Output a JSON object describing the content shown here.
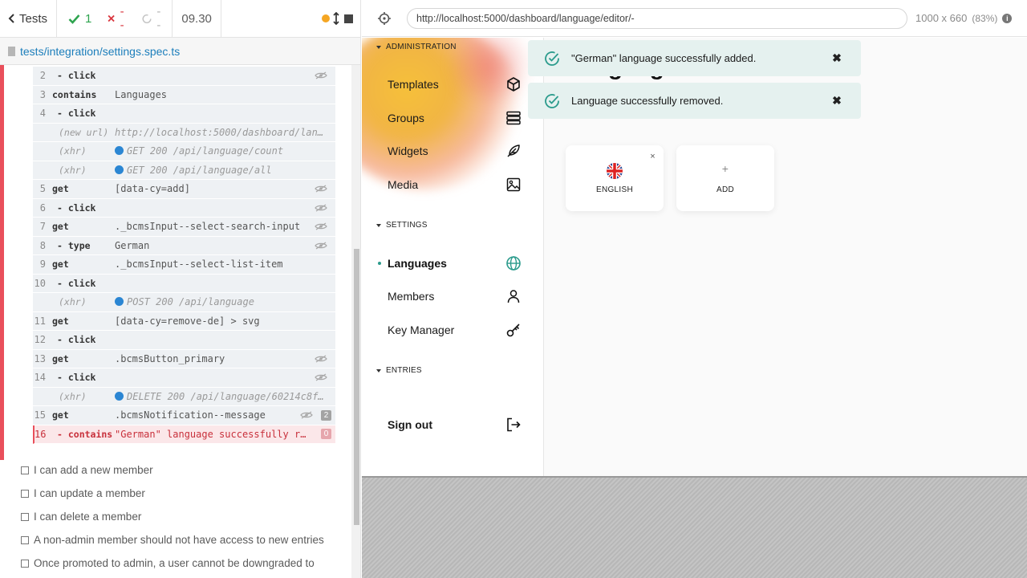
{
  "reporter": {
    "back_label": "Tests",
    "passed": "1",
    "failed": "--",
    "pending": "--",
    "duration": "09.30",
    "spec_path": "tests/integration/settings.spec.ts"
  },
  "commands": [
    {
      "num": "2",
      "name": "- click",
      "msg": "",
      "kind": "sub",
      "eye": true
    },
    {
      "num": "3",
      "name": "contains",
      "msg": "Languages",
      "kind": "cmd"
    },
    {
      "num": "4",
      "name": "- click",
      "msg": "",
      "kind": "sub"
    },
    {
      "num": "",
      "name": "(new url)",
      "msg": "http://localhost:5000/dashboard/lan…",
      "kind": "event"
    },
    {
      "num": "",
      "name": "(xhr)",
      "msg": "GET 200 /api/language/count",
      "kind": "event",
      "xhr": true
    },
    {
      "num": "",
      "name": "(xhr)",
      "msg": "GET 200 /api/language/all",
      "kind": "event",
      "xhr": true
    },
    {
      "num": "5",
      "name": "get",
      "msg": "[data-cy=add]",
      "kind": "cmd",
      "eye": true
    },
    {
      "num": "6",
      "name": "- click",
      "msg": "",
      "kind": "sub",
      "eye": true
    },
    {
      "num": "7",
      "name": "get",
      "msg": "._bcmsInput--select-search-input",
      "kind": "cmd",
      "eye": true
    },
    {
      "num": "8",
      "name": "- type",
      "msg": "German",
      "kind": "sub",
      "eye": true
    },
    {
      "num": "9",
      "name": "get",
      "msg": "._bcmsInput--select-list-item",
      "kind": "cmd"
    },
    {
      "num": "10",
      "name": "- click",
      "msg": "",
      "kind": "sub"
    },
    {
      "num": "",
      "name": "(xhr)",
      "msg": "POST 200 /api/language",
      "kind": "event",
      "xhr": true
    },
    {
      "num": "11",
      "name": "get",
      "msg": "[data-cy=remove-de] > svg",
      "kind": "cmd"
    },
    {
      "num": "12",
      "name": "- click",
      "msg": "",
      "kind": "sub"
    },
    {
      "num": "13",
      "name": "get",
      "msg": ".bcmsButton_primary",
      "kind": "cmd",
      "eye": true
    },
    {
      "num": "14",
      "name": "- click",
      "msg": "",
      "kind": "sub",
      "eye": true
    },
    {
      "num": "",
      "name": "(xhr)",
      "msg": "DELETE 200 /api/language/60214c8f…",
      "kind": "event",
      "xhr": true
    },
    {
      "num": "15",
      "name": "get",
      "msg": ".bcmsNotification--message",
      "kind": "cmd",
      "eye": true,
      "badge": "2"
    },
    {
      "num": "16",
      "name": "- contains",
      "msg": "\"German\" language successfully r…",
      "kind": "failed",
      "badge": "0"
    }
  ],
  "tests": [
    "I can add a new member",
    "I can update a member",
    "I can delete a member",
    "A non-admin member should not have access to new entries",
    "Once promoted to admin, a user cannot be downgraded to"
  ],
  "browser": {
    "url": "http://localhost:5000/dashboard/language/editor/-",
    "viewport": "1000 x 660",
    "zoom": "(83%)"
  },
  "sidebar": {
    "administration": "ADMINISTRATION",
    "settings": "SETTINGS",
    "entries": "ENTRIES",
    "items": {
      "templates": "Templates",
      "groups": "Groups",
      "widgets": "Widgets",
      "media": "Media",
      "languages": "Languages",
      "members": "Members",
      "key_manager": "Key Manager",
      "sign_out": "Sign out"
    }
  },
  "main": {
    "title": "Language",
    "toasts": [
      "\"German\" language successfully added.",
      "Language successfully removed."
    ],
    "languages": [
      {
        "label": "ENGLISH"
      }
    ],
    "add_label": "ADD",
    "close_glyph": "✖",
    "card_close_glyph": "×",
    "plus_glyph": "+"
  },
  "colors": {
    "accent": "#2b9b8c",
    "fail": "#e94f5b",
    "pass": "#2ea44f",
    "xhr": "#2b86d3"
  }
}
